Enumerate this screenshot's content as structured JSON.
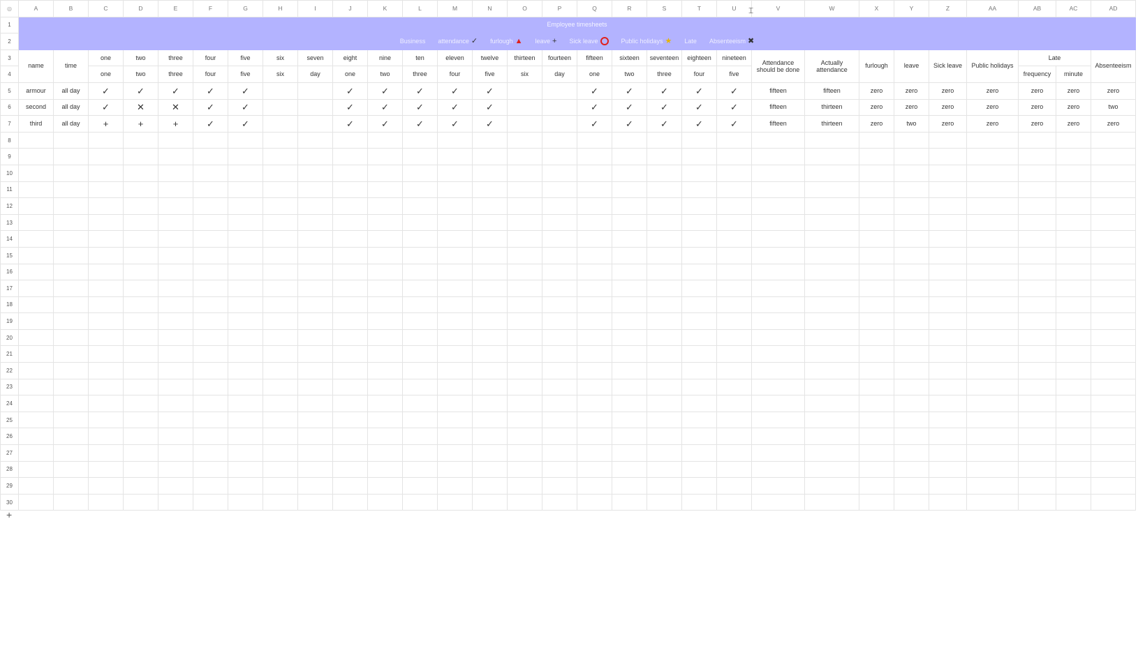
{
  "sheet": {
    "corner_icon": "eye-icon",
    "columns": [
      "A",
      "B",
      "C",
      "D",
      "E",
      "F",
      "G",
      "H",
      "I",
      "J",
      "K",
      "L",
      "M",
      "N",
      "O",
      "P",
      "Q",
      "R",
      "S",
      "T",
      "U",
      "V",
      "W",
      "X",
      "Y",
      "Z",
      "AA",
      "AB",
      "AC",
      "AD"
    ],
    "row_numbers": [
      "1",
      "2",
      "3",
      "4",
      "5",
      "6",
      "7",
      "8",
      "9",
      "10",
      "11",
      "12",
      "13",
      "14",
      "15",
      "16",
      "17",
      "18",
      "19",
      "20",
      "21",
      "22",
      "23",
      "24",
      "25",
      "26",
      "27",
      "28",
      "29",
      "30"
    ],
    "title": "Employee timesheets",
    "legend": [
      {
        "label": "Business",
        "mark": ""
      },
      {
        "label": "attendance",
        "mark": "✓"
      },
      {
        "label": "furlough",
        "mark": "▲"
      },
      {
        "label": "leave",
        "mark": "+"
      },
      {
        "label": "Sick leave",
        "mark": "ring"
      },
      {
        "label": "Public holidays",
        "mark": "★"
      },
      {
        "label": "Late",
        "mark": ""
      },
      {
        "label": "Absenteeism",
        "mark": "✖"
      }
    ],
    "headers": {
      "name": "name",
      "time": "time",
      "day_numbers": [
        "one",
        "two",
        "three",
        "four",
        "five",
        "six",
        "seven",
        "eight",
        "nine",
        "ten",
        "eleven",
        "twelve",
        "thirteen",
        "fourteen",
        "fifteen",
        "sixteen",
        "seventeen",
        "eighteen",
        "nineteen"
      ],
      "weekdays": [
        "one",
        "two",
        "three",
        "four",
        "five",
        "six",
        "day",
        "one",
        "two",
        "three",
        "four",
        "five",
        "six",
        "day",
        "one",
        "two",
        "three",
        "four",
        "five"
      ],
      "should_attend": "Attendance should be done",
      "actual_attend": "Actually attendance",
      "furlough": "furlough",
      "leave": "leave",
      "sick_leave": "Sick leave",
      "public_holidays": "Public holidays",
      "late": "Late",
      "late_frequency": "frequency",
      "late_minute": "minute",
      "absenteeism": "Absenteeism"
    },
    "employees": [
      {
        "name": "armour",
        "time": "all day",
        "days": [
          "✓",
          "✓",
          "✓",
          "✓",
          "✓",
          "",
          "",
          "✓",
          "✓",
          "✓",
          "✓",
          "✓",
          "",
          "",
          "✓",
          "✓",
          "✓",
          "✓",
          "✓"
        ],
        "should": "fifteen",
        "actual": "fifteen",
        "furlough": "zero",
        "leave": "zero",
        "sick": "zero",
        "public": "zero",
        "late_freq": "zero",
        "late_min": "zero",
        "absent": "zero"
      },
      {
        "name": "second",
        "time": "all day",
        "days": [
          "✓",
          "✕",
          "✕",
          "✓",
          "✓",
          "",
          "",
          "✓",
          "✓",
          "✓",
          "✓",
          "✓",
          "",
          "",
          "✓",
          "✓",
          "✓",
          "✓",
          "✓"
        ],
        "should": "fifteen",
        "actual": "thirteen",
        "furlough": "zero",
        "leave": "zero",
        "sick": "zero",
        "public": "zero",
        "late_freq": "zero",
        "late_min": "zero",
        "absent": "two"
      },
      {
        "name": "third",
        "time": "all day",
        "days": [
          "+",
          "+",
          "+",
          "✓",
          "✓",
          "",
          "",
          "✓",
          "✓",
          "✓",
          "✓",
          "✓",
          "",
          "",
          "✓",
          "✓",
          "✓",
          "✓",
          "✓"
        ],
        "should": "fifteen",
        "actual": "thirteen",
        "furlough": "zero",
        "leave": "two",
        "sick": "zero",
        "public": "zero",
        "late_freq": "zero",
        "late_min": "zero",
        "absent": "zero"
      }
    ],
    "add_row_icon": "plus-icon",
    "resize_cursor_icon": "column-resize-cursor-icon"
  }
}
